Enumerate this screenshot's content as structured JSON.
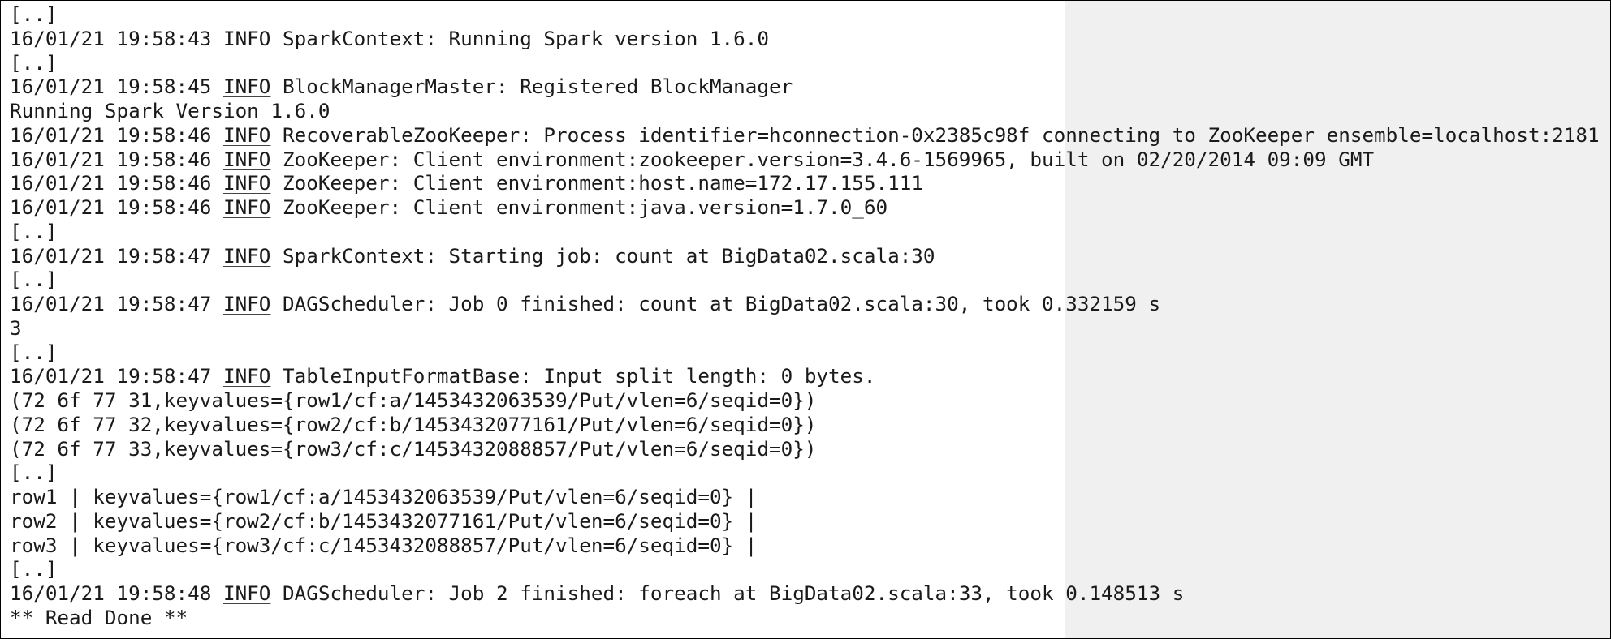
{
  "log": {
    "lines": [
      {
        "type": "ellipsis",
        "text": "[..]"
      },
      {
        "type": "entry",
        "ts": "16/01/21 19:58:43",
        "level": "INFO",
        "msg": "SparkContext: Running Spark version 1.6.0"
      },
      {
        "type": "ellipsis",
        "text": "[..]"
      },
      {
        "type": "entry",
        "ts": "16/01/21 19:58:45",
        "level": "INFO",
        "msg": "BlockManagerMaster: Registered BlockManager"
      },
      {
        "type": "plain",
        "text": "Running Spark Version 1.6.0"
      },
      {
        "type": "entry",
        "ts": "16/01/21 19:58:46",
        "level": "INFO",
        "msg": "RecoverableZooKeeper: Process identifier=hconnection-0x2385c98f connecting to ZooKeeper ensemble=localhost:2181"
      },
      {
        "type": "entry",
        "ts": "16/01/21 19:58:46",
        "level": "INFO",
        "msg": "ZooKeeper: Client environment:zookeeper.version=3.4.6-1569965, built on 02/20/2014 09:09 GMT"
      },
      {
        "type": "entry",
        "ts": "16/01/21 19:58:46",
        "level": "INFO",
        "msg": "ZooKeeper: Client environment:host.name=172.17.155.111"
      },
      {
        "type": "entry",
        "ts": "16/01/21 19:58:46",
        "level": "INFO",
        "msg": "ZooKeeper: Client environment:java.version=1.7.0_60"
      },
      {
        "type": "ellipsis",
        "text": "[..]"
      },
      {
        "type": "entry",
        "ts": "16/01/21 19:58:47",
        "level": "INFO",
        "msg": "SparkContext: Starting job: count at BigData02.scala:30"
      },
      {
        "type": "ellipsis",
        "text": "[..]"
      },
      {
        "type": "entry",
        "ts": "16/01/21 19:58:47",
        "level": "INFO",
        "msg": "DAGScheduler: Job 0 finished: count at BigData02.scala:30, took 0.332159 s"
      },
      {
        "type": "plain",
        "text": "3"
      },
      {
        "type": "ellipsis",
        "text": "[..]"
      },
      {
        "type": "entry",
        "ts": "16/01/21 19:58:47",
        "level": "INFO",
        "msg": "TableInputFormatBase: Input split length: 0 bytes."
      },
      {
        "type": "plain",
        "text": "(72 6f 77 31,keyvalues={row1/cf:a/1453432063539/Put/vlen=6/seqid=0})"
      },
      {
        "type": "plain",
        "text": "(72 6f 77 32,keyvalues={row2/cf:b/1453432077161/Put/vlen=6/seqid=0})"
      },
      {
        "type": "plain",
        "text": "(72 6f 77 33,keyvalues={row3/cf:c/1453432088857/Put/vlen=6/seqid=0})"
      },
      {
        "type": "ellipsis",
        "text": "[..]"
      },
      {
        "type": "plain",
        "text": "row1 | keyvalues={row1/cf:a/1453432063539/Put/vlen=6/seqid=0} |"
      },
      {
        "type": "plain",
        "text": "row2 | keyvalues={row2/cf:b/1453432077161/Put/vlen=6/seqid=0} |"
      },
      {
        "type": "plain",
        "text": "row3 | keyvalues={row3/cf:c/1453432088857/Put/vlen=6/seqid=0} |"
      },
      {
        "type": "ellipsis",
        "text": "[..]"
      },
      {
        "type": "entry",
        "ts": "16/01/21 19:58:48",
        "level": "INFO",
        "msg": "DAGScheduler: Job 2 finished: foreach at BigData02.scala:33, took 0.148513 s"
      },
      {
        "type": "plain",
        "text": "** Read Done **"
      }
    ]
  }
}
